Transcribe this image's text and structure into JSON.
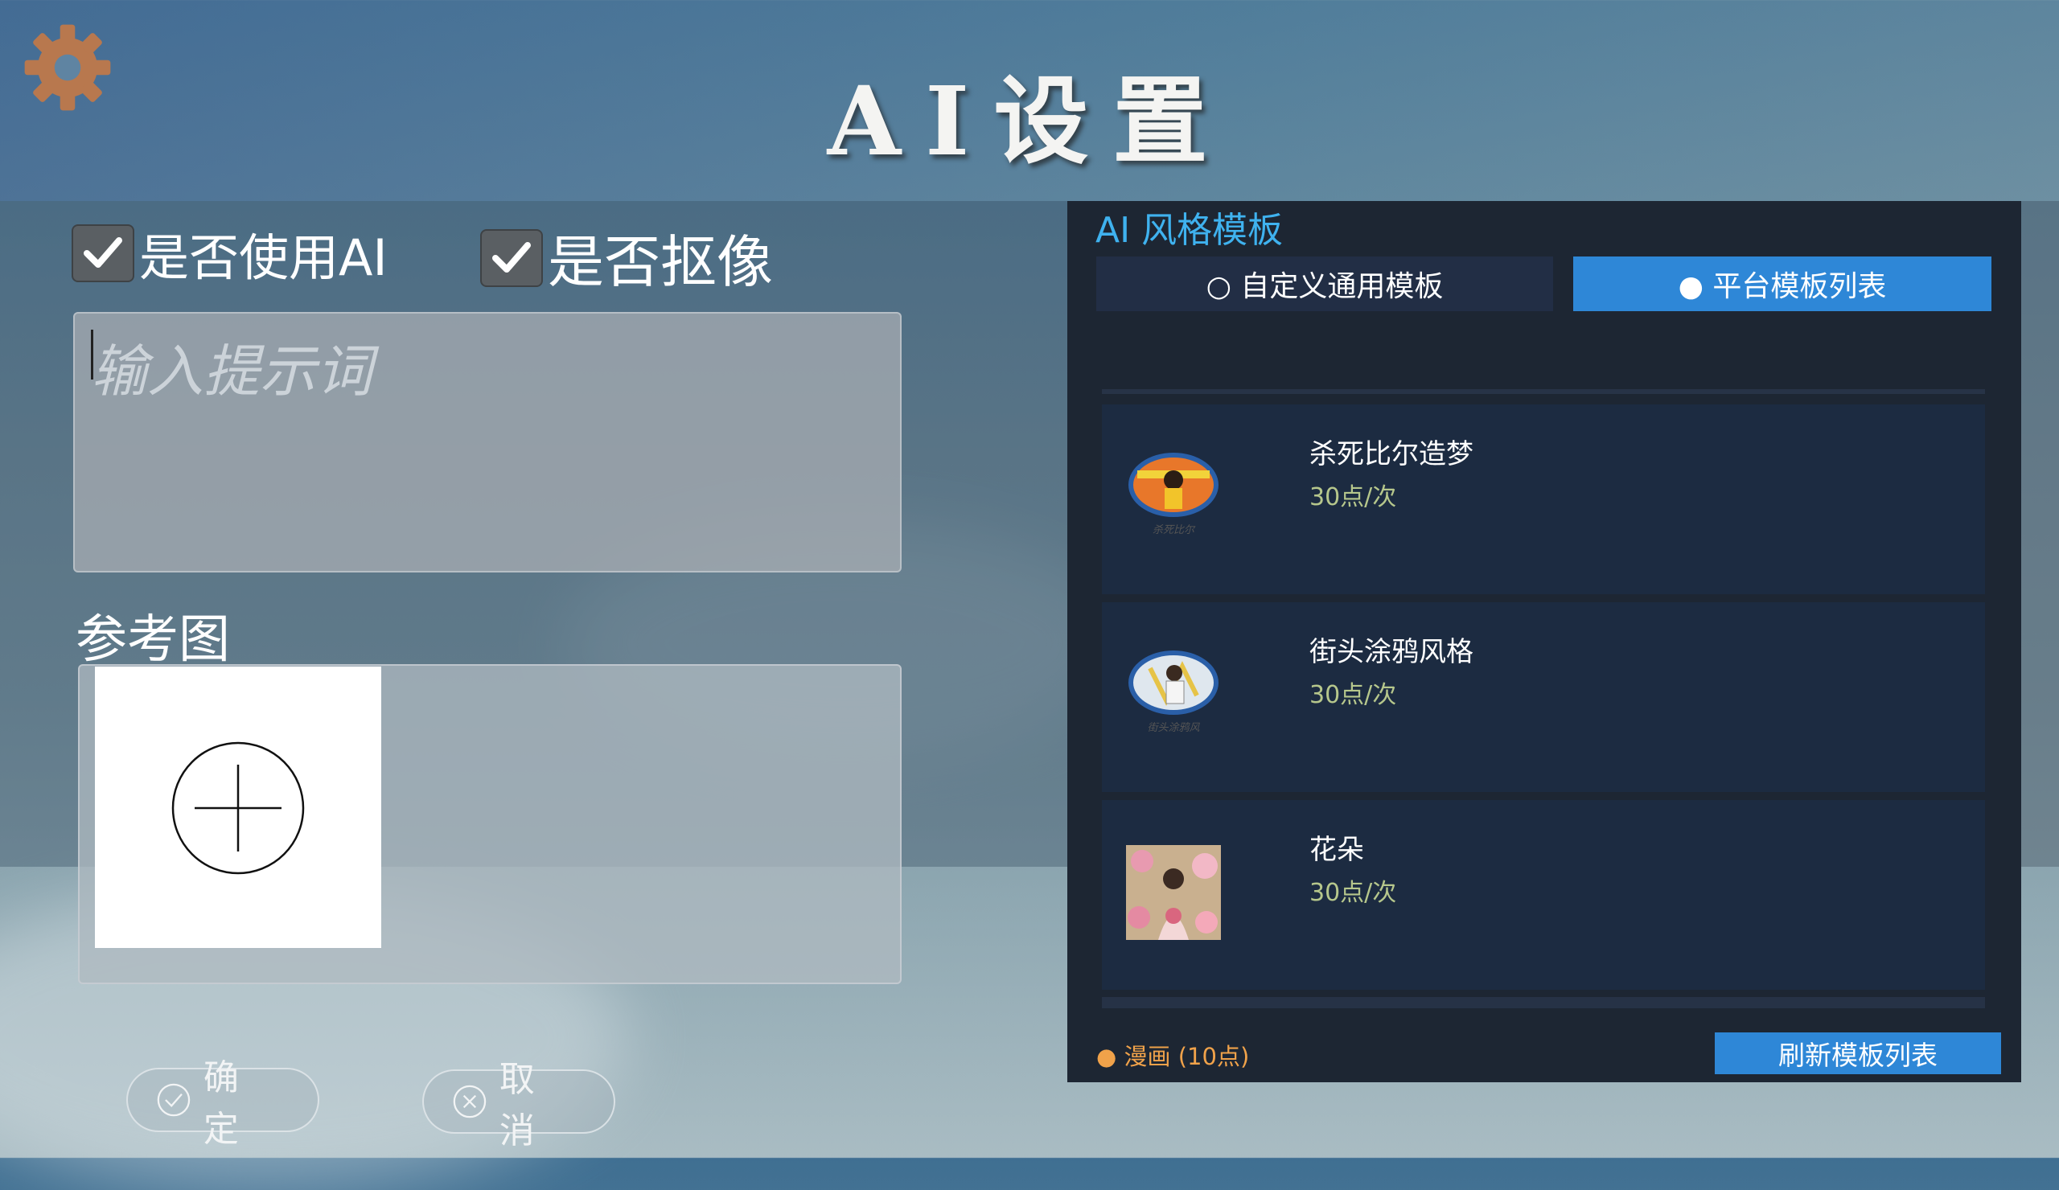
{
  "header": {
    "title": "AI设置"
  },
  "options": {
    "use_ai": {
      "label": "是否使用AI",
      "checked": true
    },
    "cutout": {
      "label": "是否抠像",
      "checked": true
    }
  },
  "prompt": {
    "placeholder": "输入提示词",
    "value": ""
  },
  "reference": {
    "label": "参考图"
  },
  "actions": {
    "confirm": "确 定",
    "cancel": "取 消"
  },
  "templates": {
    "title": "AI 风格模板",
    "tabs": [
      {
        "label": "○ 自定义通用模板",
        "active": false
      },
      {
        "label": "● 平台模板列表",
        "active": true
      }
    ],
    "items": [
      {
        "name": "杀死比尔造梦",
        "price": "30点/次",
        "thumb_caption": "杀死比尔"
      },
      {
        "name": "街头涂鸦风格",
        "price": "30点/次",
        "thumb_caption": "街头涂鸦风"
      },
      {
        "name": "花朵",
        "price": "30点/次"
      }
    ],
    "footer_note": "● 漫画 (10点)",
    "refresh_label": "刷新模板列表"
  },
  "colors": {
    "accent": "#2e87d7",
    "title_blue": "#3fb2ef",
    "panel": "#1d2633",
    "price": "#b6c78c",
    "note": "#f0a24a",
    "gear": "#b8784e"
  },
  "icons": [
    "gear-icon",
    "check-icon",
    "add-circle-icon",
    "confirm-check-icon",
    "cancel-x-icon"
  ]
}
